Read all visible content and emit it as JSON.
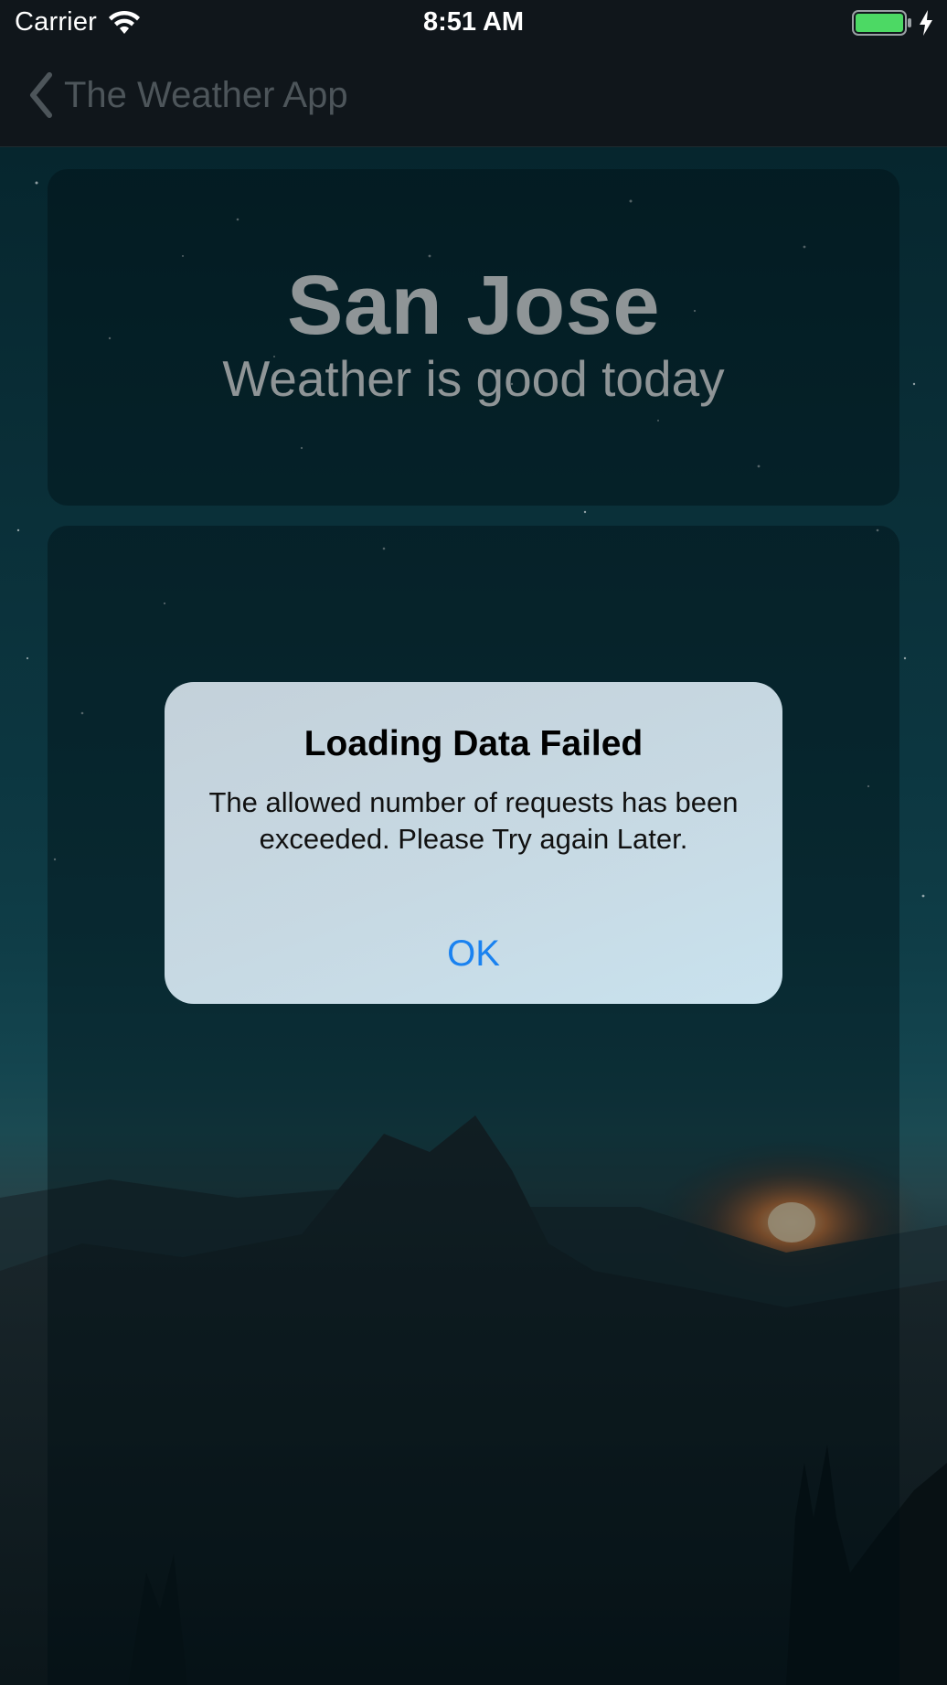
{
  "status_bar": {
    "carrier": "Carrier",
    "time": "8:51 AM"
  },
  "nav": {
    "back_label": "The Weather App"
  },
  "weather": {
    "city": "San Jose",
    "summary": "Weather is good today"
  },
  "alert": {
    "title": "Loading Data Failed",
    "message": "The allowed number of requests has been exceeded. Please Try again Later.",
    "ok_label": "OK"
  },
  "colors": {
    "accent": "#1a82f0",
    "battery": "#4cd964"
  }
}
